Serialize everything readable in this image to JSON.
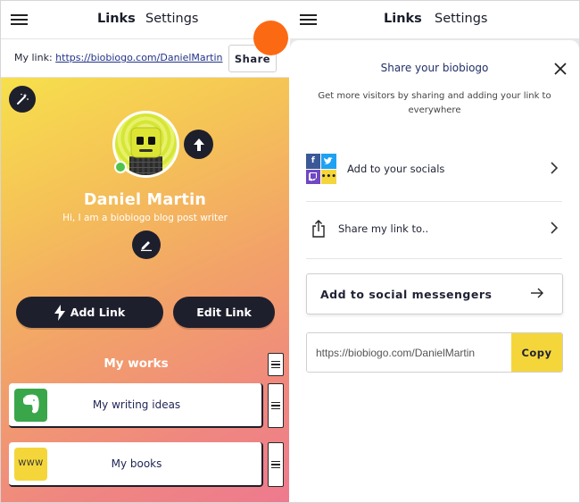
{
  "nav": {
    "links_label": "Links",
    "settings_label": "Settings"
  },
  "colors": {
    "accent_yellow": "#f5d63a",
    "dark": "#1e1f2c",
    "orange_indicator": "#fb6a13",
    "online_green": "#4fc44a"
  },
  "mylink": {
    "label": "My link:",
    "url": "https://biobiogo.com/DanielMartin",
    "share_label": "Share"
  },
  "profile": {
    "name": "Daniel Martin",
    "bio": "Hi, I am a biobiogo blog post writer",
    "status": "online"
  },
  "actions": {
    "add_link_label": "Add Link",
    "edit_link_label": "Edit Link"
  },
  "works": {
    "title": "My works",
    "items": [
      {
        "title": "My writing ideas",
        "icon": "evernote-icon"
      },
      {
        "title": "My books",
        "icon": "www-icon",
        "icon_text": "WWW"
      }
    ]
  },
  "share_sheet": {
    "title": "Share your biobiogo",
    "subtitle": "Get more visitors by sharing and adding your link to everywhere",
    "options": [
      {
        "label": "Add to your socials",
        "icon": "socials-grid-icon"
      },
      {
        "label": "Share my link to..",
        "icon": "share-icon"
      }
    ],
    "messenger_label": "Add to social messengers",
    "copy_value": "https://biobiogo.com/DanielMartin",
    "copy_label": "Copy"
  }
}
